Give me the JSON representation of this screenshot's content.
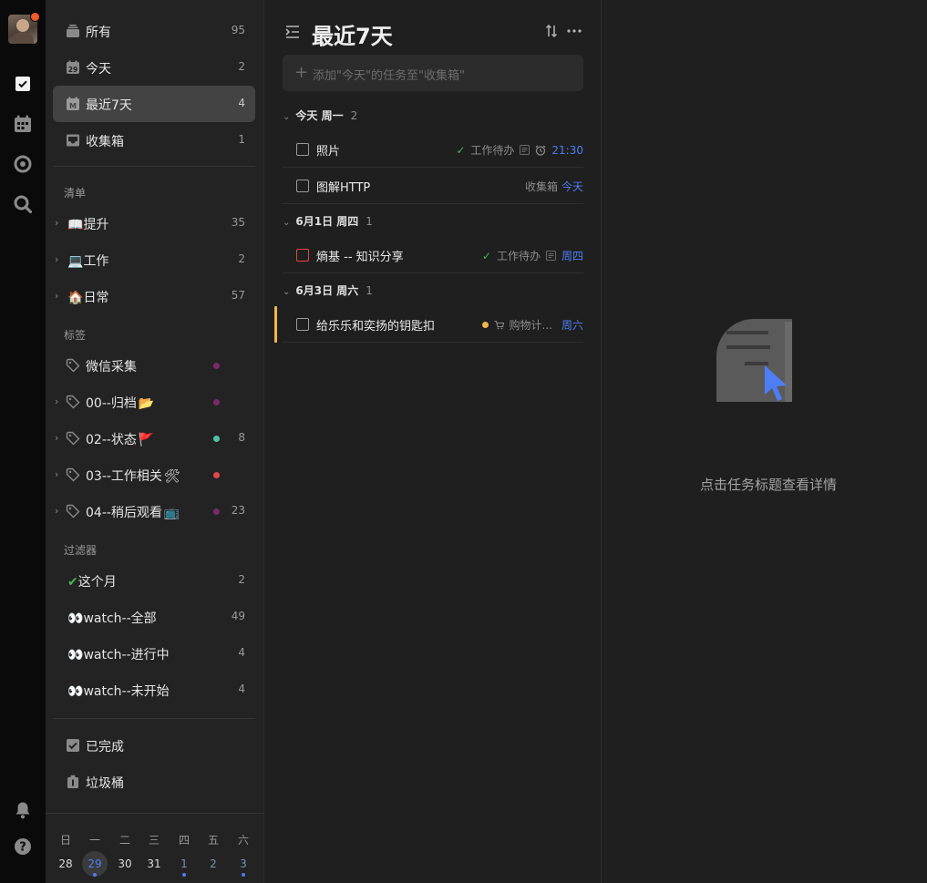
{
  "rail": {
    "items": [
      "avatar",
      "tasks",
      "calendar",
      "focus",
      "search",
      "notifications",
      "help"
    ]
  },
  "sidebar": {
    "smart": [
      {
        "label": "所有",
        "count": "95"
      },
      {
        "label": "今天",
        "count": "2"
      },
      {
        "label": "最近7天",
        "count": "4"
      },
      {
        "label": "收集箱",
        "count": "1"
      }
    ],
    "lists_header": "清单",
    "lists": [
      {
        "emoji": "📖",
        "label": "提升",
        "count": "35"
      },
      {
        "emoji": "💻",
        "label": "工作",
        "count": "2"
      },
      {
        "emoji": "🏠",
        "label": "日常",
        "count": "57"
      }
    ],
    "tags_header": "标签",
    "tags": [
      {
        "label": "微信采集",
        "emoji": "",
        "count": "",
        "color": "#7a2a6a"
      },
      {
        "label": "00--归档",
        "emoji": "📂",
        "count": "",
        "color": "#7a2a6a"
      },
      {
        "label": "02--状态",
        "emoji": "🚩",
        "count": "8",
        "color": "#4fc3a1"
      },
      {
        "label": "03--工作相关",
        "emoji": "🛠",
        "count": "",
        "color": "#e04848"
      },
      {
        "label": "04--稍后观看",
        "emoji": "📺",
        "count": "23",
        "color": "#7a2a6a"
      }
    ],
    "filters_header": "过滤器",
    "filters": [
      {
        "emoji": "✔",
        "label": "这个月",
        "count": "2"
      },
      {
        "emoji": "👀",
        "label": "watch--全部",
        "count": "49"
      },
      {
        "emoji": "👀",
        "label": "watch--进行中",
        "count": "4"
      },
      {
        "emoji": "👀",
        "label": "watch--未开始",
        "count": "4"
      }
    ],
    "bottom": [
      {
        "label": "已完成"
      },
      {
        "label": "垃圾桶"
      }
    ],
    "calendar": {
      "weekdays": [
        "日",
        "一",
        "二",
        "三",
        "四",
        "五",
        "六"
      ],
      "days": [
        "28",
        "29",
        "30",
        "31",
        "1",
        "2",
        "3"
      ]
    }
  },
  "main": {
    "title": "最近7天",
    "add_placeholder": "添加\"今天\"的任务至\"收集箱\"",
    "groups": [
      {
        "label": "今天 周一",
        "count": "2"
      },
      {
        "label": "6月1日 周四",
        "count": "1"
      },
      {
        "label": "6月3日 周六",
        "count": "1"
      }
    ],
    "tasks": [
      {
        "title": "照片",
        "list": "工作待办",
        "date": "21:30"
      },
      {
        "title": "图解HTTP",
        "list": "收集箱",
        "date": "今天"
      },
      {
        "title": "熵基 -- 知识分享",
        "list": "工作待办",
        "date": "周四"
      },
      {
        "title": "给乐乐和奕扬的钥匙扣",
        "list": "购物计...",
        "date": "周六"
      }
    ]
  },
  "detail": {
    "hint": "点击任务标题查看详情"
  },
  "colors": {
    "accent": "#4f7df5",
    "priority_red": "#e04848",
    "priority_yellow": "#f2b54a"
  }
}
